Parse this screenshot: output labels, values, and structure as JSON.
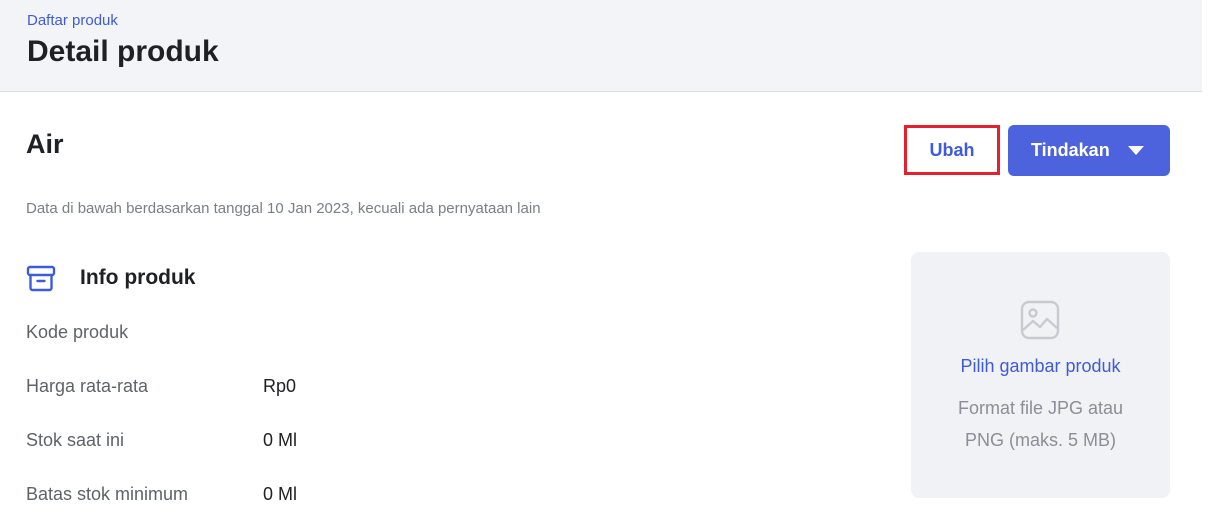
{
  "header": {
    "breadcrumb": "Daftar produk",
    "title": "Detail produk"
  },
  "product": {
    "name": "Air",
    "note": "Data di bawah berdasarkan tanggal 10 Jan 2023, kecuali ada pernyataan lain"
  },
  "actions": {
    "edit_label": "Ubah",
    "actions_label": "Tindakan",
    "actions_icon": "caret-down-icon"
  },
  "info": {
    "title": "Info produk",
    "icon": "archive-box-icon",
    "rows": [
      {
        "label": "Kode produk",
        "value": ""
      },
      {
        "label": "Harga rata-rata",
        "value": "Rp0"
      },
      {
        "label": "Stok saat ini",
        "value": "0 Ml"
      },
      {
        "label": "Batas stok minimum",
        "value": "0 Ml"
      }
    ]
  },
  "image_upload": {
    "icon": "image-placeholder-icon",
    "link": "Pilih gambar produk",
    "hint_line1": "Format file JPG atau",
    "hint_line2": "PNG (maks. 5 MB)"
  },
  "colors": {
    "accent": "#4d63de",
    "link": "#3e5bd8",
    "highlight_border": "#e32230",
    "header_bg": "#f3f4f7"
  }
}
